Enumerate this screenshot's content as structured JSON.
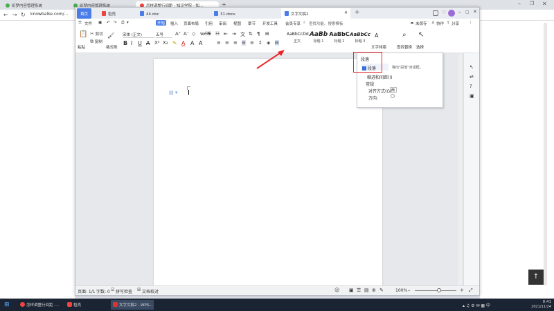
{
  "browser": {
    "tabs": [
      {
        "label": "织梦内容管理系统",
        "color": "#4caf50"
      },
      {
        "label": "织梦内容管理系统",
        "color": "#4caf50"
      },
      {
        "label": "怎样调整行间距 - 知识学院 - 知…",
        "color": "#e44"
      }
    ],
    "new_tab": "+",
    "url": "knowbalke.com/..."
  },
  "wps": {
    "tabs": {
      "home": "首页",
      "daoke": "稻壳",
      "doc1": "44.doc",
      "doc2": "31.docx",
      "doc3": "文字文稿2",
      "add": "+"
    },
    "menu": {
      "file": "文件",
      "start": "开始",
      "insert": "插入",
      "layout": "页面布局",
      "reference": "引用",
      "review": "审阅",
      "view": "视图",
      "section": "章节",
      "dev": "开发工具",
      "vip": "会员专享",
      "search": "查找功能、搜索模板",
      "unsaved": "未保存",
      "collab": "协作",
      "share": "分享"
    },
    "ribbon": {
      "paste": "粘贴",
      "cut": "剪切",
      "copy": "复制",
      "format_painter": "格式刷",
      "font": "宋体 (正文)",
      "size": "五号",
      "styles": [
        {
          "sample": "AaBbCcDd",
          "label": "正文"
        },
        {
          "sample": "AaBb",
          "label": "标题 1"
        },
        {
          "sample": "AaBbC",
          "label": "标题 2"
        },
        {
          "sample": "AaBbCc",
          "label": "标题 3"
        }
      ],
      "text_layout": "文字排版",
      "find_replace": "查找替换",
      "select": "选择"
    },
    "dropdown": {
      "title": "段落",
      "item_paragraph": "段落",
      "tip": "弹出\"段落\"对话框。",
      "indent_spacing": "缩进和间距(I)",
      "general": "常规",
      "align": "对齐方式(G)",
      "align_value": "两",
      "direction": "方向:"
    },
    "status": {
      "page": "页面: 1/1",
      "words": "字数: 0",
      "spell": "拼写检查",
      "proof": "文档校对",
      "zoom": "100%"
    }
  },
  "taskbar": {
    "item1": "怎样调整行间距 -...",
    "item2": "稻壳",
    "item3": "文字文稿2 - WPS...",
    "time": "8:41",
    "date": "2021/11/24"
  },
  "back_to_top": "↑"
}
